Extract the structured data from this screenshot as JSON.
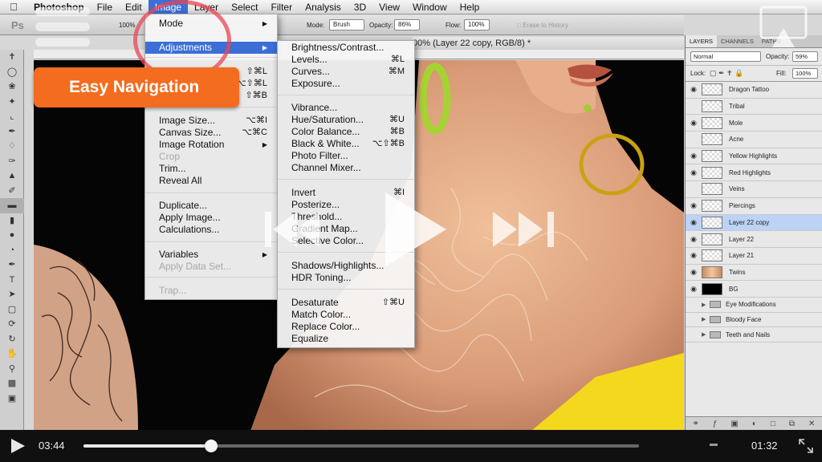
{
  "menubar": {
    "items": [
      "Photoshop",
      "File",
      "Edit",
      "Image",
      "Layer",
      "Select",
      "Filter",
      "Analysis",
      "3D",
      "View",
      "Window",
      "Help"
    ]
  },
  "options_bar": {
    "app_glyph": "Ps",
    "zoom": "100%",
    "mode_label": "Mode:",
    "mode_value": "Brush",
    "opacity_label": "Opacity:",
    "opacity_value": "86%",
    "flow_label": "Flow:",
    "flow_value": "100%",
    "erase_history": "Erase to History"
  },
  "document": {
    "title": "00% (Layer 22 copy, RGB/8) *"
  },
  "image_menu": {
    "items": [
      {
        "label": "Mode",
        "shortcut": "",
        "disabled": false,
        "submenu": true
      },
      {
        "label": "Adjustments",
        "shortcut": "",
        "disabled": false,
        "submenu": true,
        "highlighted": true
      },
      {
        "label": "",
        "shortcut": "⇧⌘L",
        "disabled": false
      },
      {
        "label": "",
        "shortcut": "⌥⇧⌘L",
        "disabled": false
      },
      {
        "label": "",
        "shortcut": "⇧⌘B",
        "disabled": false
      },
      {
        "label": "Image Size...",
        "shortcut": "⌥⌘I",
        "disabled": false
      },
      {
        "label": "Canvas Size...",
        "shortcut": "⌥⌘C",
        "disabled": false
      },
      {
        "label": "Image Rotation",
        "shortcut": "",
        "disabled": false,
        "submenu": true
      },
      {
        "label": "Crop",
        "shortcut": "",
        "disabled": true
      },
      {
        "label": "Trim...",
        "shortcut": "",
        "disabled": false
      },
      {
        "label": "Reveal All",
        "shortcut": "",
        "disabled": false
      },
      {
        "label": "Duplicate...",
        "shortcut": "",
        "disabled": false
      },
      {
        "label": "Apply Image...",
        "shortcut": "",
        "disabled": false
      },
      {
        "label": "Calculations...",
        "shortcut": "",
        "disabled": false
      },
      {
        "label": "Variables",
        "shortcut": "",
        "disabled": false,
        "submenu": true
      },
      {
        "label": "Apply Data Set...",
        "shortcut": "",
        "disabled": true
      },
      {
        "label": "Trap...",
        "shortcut": "",
        "disabled": true
      }
    ]
  },
  "adjustments_menu": {
    "items": [
      {
        "label": "Brightness/Contrast...",
        "shortcut": ""
      },
      {
        "label": "Levels...",
        "shortcut": "⌘L"
      },
      {
        "label": "Curves...",
        "shortcut": "⌘M"
      },
      {
        "label": "Exposure...",
        "shortcut": ""
      },
      {
        "label": "Vibrance...",
        "shortcut": ""
      },
      {
        "label": "Hue/Saturation...",
        "shortcut": "⌘U"
      },
      {
        "label": "Color Balance...",
        "shortcut": "⌘B"
      },
      {
        "label": "Black & White...",
        "shortcut": "⌥⇧⌘B"
      },
      {
        "label": "Photo Filter...",
        "shortcut": ""
      },
      {
        "label": "Channel Mixer...",
        "shortcut": ""
      },
      {
        "label": "Invert",
        "shortcut": "⌘I"
      },
      {
        "label": "Posterize...",
        "shortcut": ""
      },
      {
        "label": "Threshold...",
        "shortcut": ""
      },
      {
        "label": "Gradient Map...",
        "shortcut": ""
      },
      {
        "label": "Selective Color...",
        "shortcut": ""
      },
      {
        "label": "Shadows/Highlights...",
        "shortcut": ""
      },
      {
        "label": "HDR Toning...",
        "shortcut": ""
      },
      {
        "label": "Desaturate",
        "shortcut": "⇧⌘U"
      },
      {
        "label": "Match Color...",
        "shortcut": ""
      },
      {
        "label": "Replace Color...",
        "shortcut": ""
      },
      {
        "label": "Equalize",
        "shortcut": ""
      }
    ]
  },
  "layers_panel": {
    "tabs": [
      "LAYERS",
      "CHANNELS",
      "PATHS"
    ],
    "blend_mode": "Normal",
    "opacity_label": "Opacity:",
    "opacity_value": "59%",
    "lock_label": "Lock:",
    "fill_label": "Fill:",
    "fill_value": "100%",
    "layers": [
      {
        "name": "Dragon Tattoo",
        "visible": true,
        "thumb": "checker"
      },
      {
        "name": "Tribal",
        "visible": false,
        "thumb": "checker"
      },
      {
        "name": "Mole",
        "visible": true,
        "thumb": "checker"
      },
      {
        "name": "Acne",
        "visible": false,
        "thumb": "checker"
      },
      {
        "name": "Yellow Highlights",
        "visible": true,
        "thumb": "checker"
      },
      {
        "name": "Red Highlights",
        "visible": true,
        "thumb": "checker"
      },
      {
        "name": "Veins",
        "visible": false,
        "thumb": "checker"
      },
      {
        "name": "Piercings",
        "visible": true,
        "thumb": "checker"
      },
      {
        "name": "Layer 22 copy",
        "visible": true,
        "thumb": "checker",
        "selected": true
      },
      {
        "name": "Layer 22",
        "visible": true,
        "thumb": "checker"
      },
      {
        "name": "Layer 21",
        "visible": true,
        "thumb": "checker"
      },
      {
        "name": "Twins",
        "visible": true,
        "thumb": "twins"
      },
      {
        "name": "BG",
        "visible": true,
        "thumb": "black"
      }
    ],
    "groups": [
      "Eye Modifications",
      "Bloody Face",
      "Teeth and Nails"
    ]
  },
  "overlay": {
    "easy_navigation": "Easy Navigation"
  },
  "player": {
    "current_time": "03:44",
    "remaining_time": "01:32",
    "progress_fraction": 0.23
  },
  "colors": {
    "menu_highlight": "#3b6fd6",
    "badge_orange": "#f36c1f",
    "circle_red": "#e84655"
  }
}
